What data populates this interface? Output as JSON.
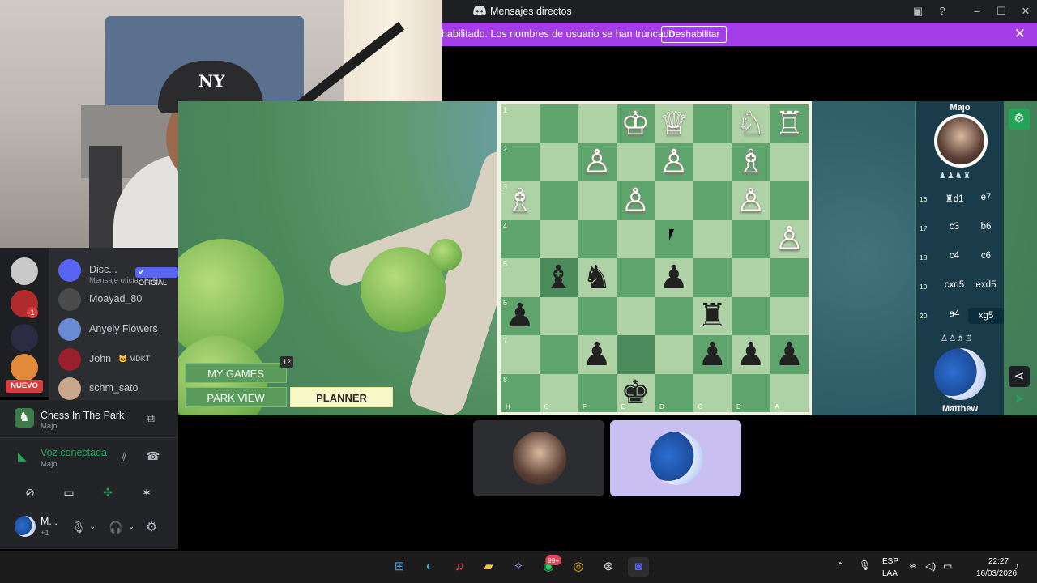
{
  "window": {
    "title": "Mensajes directos"
  },
  "notice": {
    "text": "habilitado. Los nombres de usuario se han truncado.",
    "button": "Deshabilitar"
  },
  "webcam": {
    "cap_logo": "NY"
  },
  "activity": {
    "menu": {
      "my_games": "MY GAMES",
      "my_games_badge": "12",
      "park_view": "PARK VIEW",
      "planner": "PLANNER"
    }
  },
  "board": {
    "rows": [
      {
        "rank": "1",
        "cells": [
          "",
          "",
          "",
          "♔",
          "♕",
          "",
          "♘",
          "♖"
        ],
        "colors": [
          "w",
          "w",
          "w",
          "w",
          "w",
          "w",
          "w",
          "w"
        ]
      },
      {
        "rank": "2",
        "cells": [
          "",
          "",
          "♙",
          "",
          "♙",
          "",
          "♗",
          ""
        ],
        "colors": [
          "w",
          "w",
          "w",
          "w",
          "w",
          "w",
          "w",
          "w"
        ]
      },
      {
        "rank": "3",
        "cells": [
          "♗",
          "",
          "",
          "♙",
          "",
          "",
          "♙",
          ""
        ],
        "colors": [
          "w",
          "w",
          "w",
          "w",
          "w",
          "w",
          "w",
          "w"
        ]
      },
      {
        "rank": "4",
        "cells": [
          "",
          "",
          "",
          "",
          "",
          "",
          "",
          "♙"
        ],
        "colors": [
          "w",
          "w",
          "w",
          "w",
          "w",
          "w",
          "w",
          "w"
        ]
      },
      {
        "rank": "5",
        "cells": [
          "",
          "♝",
          "♞",
          "",
          "♟",
          "",
          "",
          ""
        ],
        "colors": [
          "b",
          "b",
          "b",
          "b",
          "b",
          "b",
          "b",
          "b"
        ]
      },
      {
        "rank": "6",
        "cells": [
          "♟",
          "",
          "",
          "",
          "",
          "♜",
          "",
          ""
        ],
        "colors": [
          "b",
          "b",
          "b",
          "b",
          "b",
          "b",
          "b",
          "b"
        ]
      },
      {
        "rank": "7",
        "cells": [
          "",
          "",
          "♟",
          "",
          "",
          "♟",
          "♟",
          "♟"
        ],
        "colors": [
          "b",
          "b",
          "b",
          "b",
          "b",
          "b",
          "b",
          "b"
        ]
      },
      {
        "rank": "8",
        "cells": [
          "",
          "",
          "",
          "♚",
          "",
          "",
          "",
          ""
        ],
        "colors": [
          "b",
          "b",
          "b",
          "b",
          "b",
          "b",
          "b",
          "b"
        ]
      }
    ],
    "files": [
      "H",
      "G",
      "F",
      "E",
      "D",
      "C",
      "B",
      "A"
    ],
    "highlight": [
      [
        4,
        1
      ],
      [
        6,
        3
      ]
    ]
  },
  "players": {
    "top": {
      "name": "Majo",
      "captured": "♟♟♞♜"
    },
    "bottom": {
      "name": "Matthew",
      "captured": "♙♙♗♖"
    }
  },
  "moves": [
    {
      "n": "16",
      "w": "♜d1",
      "b": "e7",
      "sel": false
    },
    {
      "n": "17",
      "w": "c3",
      "b": "b6",
      "sel": false
    },
    {
      "n": "18",
      "w": "c4",
      "b": "c6",
      "sel": false
    },
    {
      "n": "19",
      "w": "cxd5",
      "b": "exd5",
      "sel": false
    },
    {
      "n": "20",
      "w": "a4",
      "b": "xg5",
      "sel": true
    }
  ],
  "sidebar": {
    "nuevo": "NUEVO",
    "server_badge": "1",
    "dms": [
      {
        "name": "Disc...",
        "tag": "✔ OFICIAL",
        "sub": "Mensaje oficial de Di..."
      },
      {
        "name": "Moayad_80",
        "tag": "",
        "sub": ""
      },
      {
        "name": "Anyely Flowers",
        "tag": "",
        "sub": ""
      },
      {
        "name": "John",
        "tag": "🐱 MDKT",
        "sub": ""
      },
      {
        "name": "schm_sato",
        "tag": "",
        "sub": ""
      }
    ]
  },
  "activity_card": {
    "title": "Chess In The Park",
    "sub": "Majo"
  },
  "voice": {
    "status": "Voz conectada",
    "channel": "Majo"
  },
  "user": {
    "name": "M...",
    "sub": "+1"
  },
  "taskbar": {
    "whatsapp_badge": "99+",
    "lang_top": "ESP",
    "lang_bottom": "LAA",
    "time": "22:27",
    "date": "16/03/2026"
  },
  "colors": {
    "accent": "#5865f2",
    "notice_bg": "#a43ee8",
    "voice_green": "#23a559",
    "board_dark": "#5fa46d",
    "board_light": "#aed2a5"
  }
}
